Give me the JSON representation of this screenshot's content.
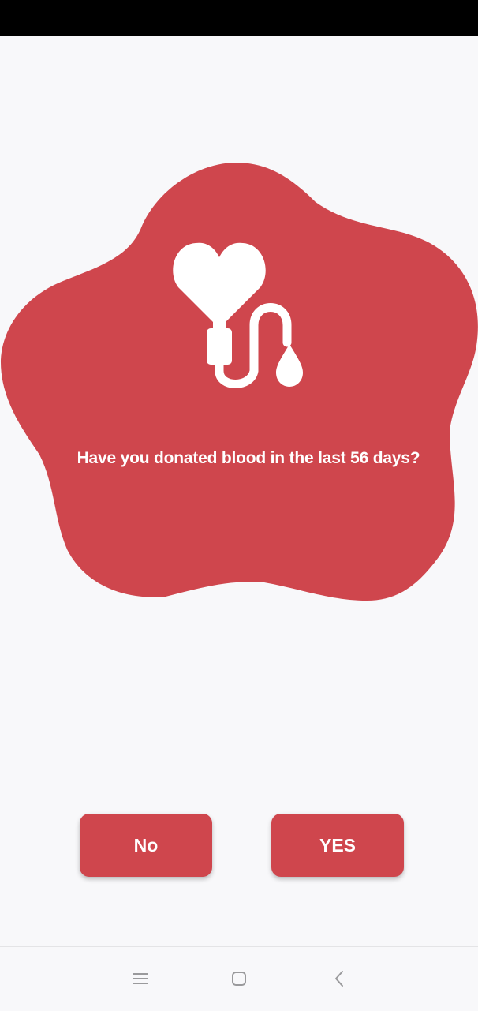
{
  "colors": {
    "accent": "#cf464d",
    "background": "#f8f8fa",
    "status_bar": "#000000",
    "text_on_accent": "#ffffff",
    "nav_icon": "#9a9a9c"
  },
  "question": {
    "text": "Have you donated blood in the last 56 days?",
    "illustration_icon": "heart-blood-transfusion-icon"
  },
  "buttons": {
    "no_label": "No",
    "yes_label": "YES"
  },
  "nav_bar": {
    "menu_icon": "menu-icon",
    "home_icon": "home-square-icon",
    "back_icon": "back-chevron-icon"
  }
}
